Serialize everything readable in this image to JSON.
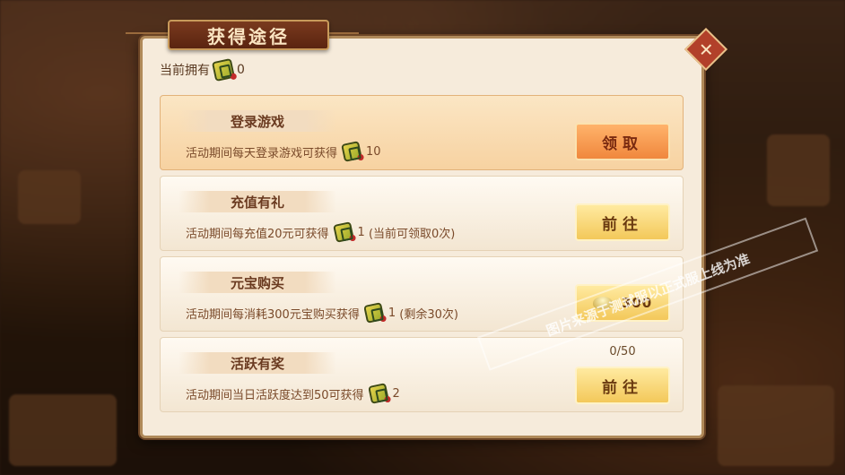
{
  "header": {
    "title": "获得途径"
  },
  "owned": {
    "label": "当前拥有",
    "count": "0"
  },
  "rows": [
    {
      "title": "登录游戏",
      "desc": "活动期间每天登录游戏可获得",
      "reward": "10",
      "extra": "",
      "button": "领取",
      "button_style": "orange"
    },
    {
      "title": "充值有礼",
      "desc": "活动期间每充值20元可获得",
      "reward": "1",
      "extra": "(当前可领取0次)",
      "button": "前往",
      "button_style": "yellow"
    },
    {
      "title": "元宝购买",
      "desc": "活动期间每消耗300元宝购买获得",
      "reward": "1",
      "extra": "(剩余30次)",
      "button": "300",
      "button_style": "yellow"
    },
    {
      "title": "活跃有奖",
      "desc": "活动期间当日活跃度达到50可获得",
      "reward": "2",
      "extra": "",
      "button": "前往",
      "button_style": "yellow",
      "progress": "0/50"
    }
  ],
  "watermark": "图片来源于测试服以正式服上线为准",
  "colors": {
    "accent": "#f0873d",
    "panel": "#f6ebdb",
    "frame": "#6c4526"
  }
}
